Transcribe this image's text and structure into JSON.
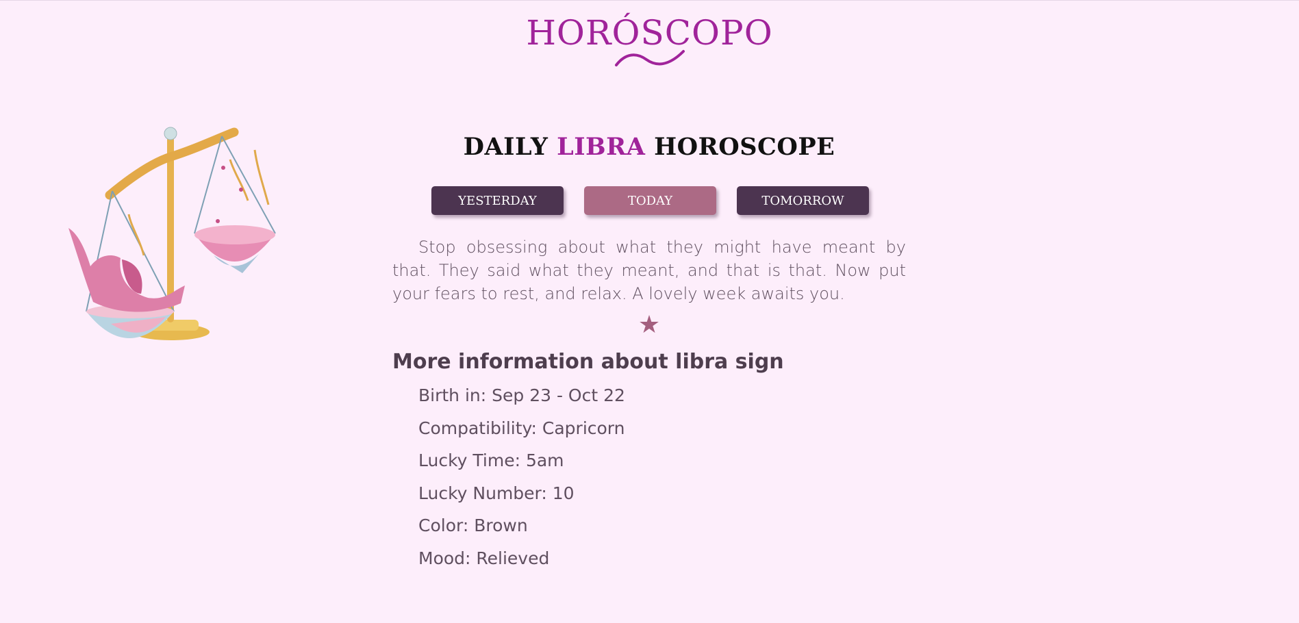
{
  "logo": {
    "text": "HORÓSCOPO",
    "color": "#a0239a"
  },
  "title": {
    "prefix": "DAILY ",
    "sign": "LIBRA",
    "suffix": " HOROSCOPE"
  },
  "tabs": [
    {
      "label": "YESTERDAY",
      "active": false
    },
    {
      "label": "TODAY",
      "active": true
    },
    {
      "label": "TOMORROW",
      "active": false
    }
  ],
  "prediction": "Stop obsessing about what they might have meant by that. They said what they meant, and that is that. Now put your fears to rest, and relax. A lovely week awaits you.",
  "divider_icon": "★",
  "more_info": {
    "heading": "More information about libra sign",
    "items": [
      "Birth in: Sep 23 - Oct 22",
      "Compatibility: Capricorn",
      "Lucky Time: 5am",
      "Lucky Number: 10",
      "Color: Brown",
      "Mood: Relieved"
    ]
  },
  "colors": {
    "background": "#fdeefb",
    "accent": "#a0239a",
    "tab": "#4c3450",
    "tab_active": "#ac6a85",
    "star": "#a45f7f"
  },
  "icons": {
    "illustration": "libra-scales-illustration",
    "divider": "star-icon"
  }
}
